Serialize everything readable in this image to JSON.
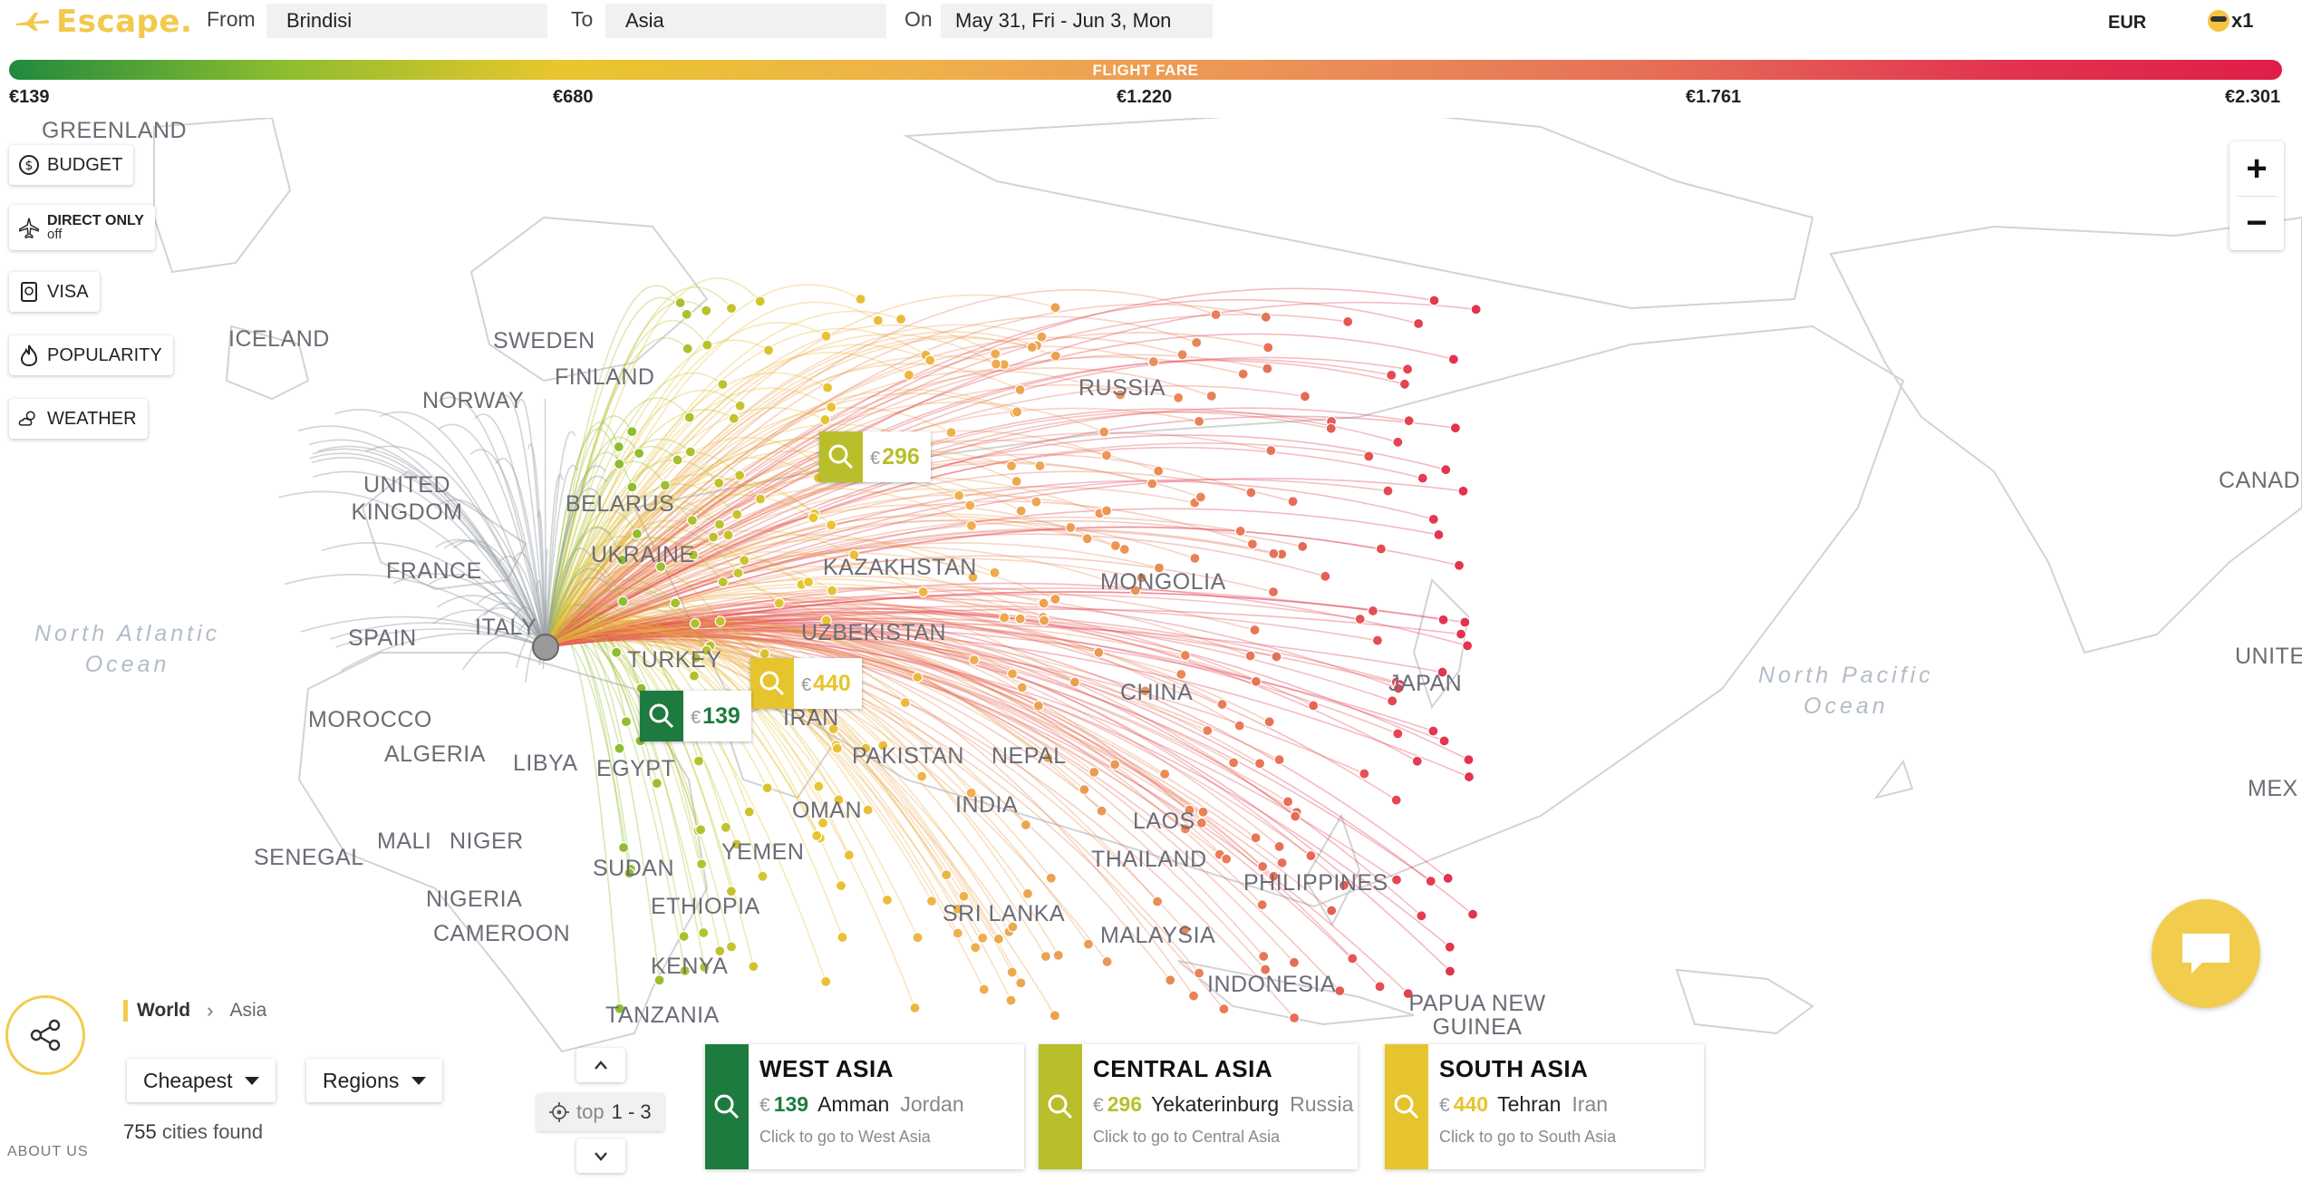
{
  "app": {
    "brand": "Escape."
  },
  "search": {
    "from_label": "From",
    "from_value": "Brindisi",
    "to_label": "To",
    "to_value": "Asia",
    "on_label": "On",
    "on_value": "May 31, Fri - Jun 3, Mon"
  },
  "currency": "EUR",
  "travelers": "x1",
  "fare_scale": {
    "title": "FLIGHT FARE",
    "ticks": [
      "€139",
      "€680",
      "€1.220",
      "€1.761",
      "€2.301"
    ]
  },
  "filters": {
    "budget": "BUDGET",
    "direct_only": "DIRECT ONLY",
    "direct_only_state": "off",
    "visa": "VISA",
    "popularity": "POPULARITY",
    "weather": "WEATHER"
  },
  "zoom": {
    "in": "+",
    "out": "−"
  },
  "map_labels": {
    "greenland": "GREENLAND",
    "iceland": "ICELAND",
    "sweden": "SWEDEN",
    "finland": "FINLAND",
    "norway": "NORWAY",
    "russia": "RUSSIA",
    "uk": "UNITED KINGDOM",
    "belarus": "BELARUS",
    "ukraine": "UKRAINE",
    "france": "FRANCE",
    "spain": "SPAIN",
    "italy": "ITALY",
    "kazakhstan": "KAZAKHSTAN",
    "mongolia": "MONGOLIA",
    "uzbekistan": "UZBEKISTAN",
    "turkey": "TURKEY",
    "iran": "IRAN",
    "china": "CHINA",
    "japan": "JAPAN",
    "morocco": "MOROCCO",
    "algeria": "ALGERIA",
    "libya": "LIBYA",
    "egypt": "EGYPT",
    "pakistan": "PAKISTAN",
    "nepal": "NEPAL",
    "india": "INDIA",
    "oman": "OMAN",
    "laos": "LAOS",
    "thailand": "THAILAND",
    "senegal": "SENEGAL",
    "mali": "MALI",
    "niger": "NIGER",
    "sudan": "SUDAN",
    "yemen": "YEMEN",
    "nigeria": "NIGERIA",
    "ethiopia": "ETHIOPIA",
    "philippines": "PHILIPPINES",
    "sri_lanka": "SRI LANKA",
    "cameroon": "CAMEROON",
    "malaysia": "MALAYSIA",
    "kenya": "KENYA",
    "indonesia": "INDONESIA",
    "papua": "PAPUA NEW GUINEA",
    "tanzania": "TANZANIA",
    "canada": "CANAD",
    "united": "UNITE",
    "mexico": "MEX",
    "n_atlantic": "North Atlantic\nOcean",
    "n_pacific": "North Pacific\nOcean"
  },
  "markers": [
    {
      "currency": "€",
      "price": "139",
      "color": "#1e7b3f"
    },
    {
      "currency": "€",
      "price": "296",
      "color": "#b8bf2a"
    },
    {
      "currency": "€",
      "price": "440",
      "color": "#e6c42e"
    }
  ],
  "breadcrumb": {
    "world": "World",
    "current": "Asia"
  },
  "sort": {
    "selected": "Cheapest"
  },
  "grouping": {
    "selected": "Regions"
  },
  "results": {
    "count": "755",
    "label": "cities found"
  },
  "footer": {
    "about": "ABOUT US"
  },
  "pager": {
    "label": "top",
    "range": "1 - 3"
  },
  "cards": [
    {
      "title": "WEST ASIA",
      "currency": "€",
      "price": "139",
      "city": "Amman",
      "country": "Jordan",
      "hint": "Click to go to West Asia",
      "color": "#1e7b3f"
    },
    {
      "title": "CENTRAL ASIA",
      "currency": "€",
      "price": "296",
      "city": "Yekaterinburg",
      "country": "Russia",
      "hint": "Click to go to Central Asia",
      "color": "#b8bf2a"
    },
    {
      "title": "SOUTH ASIA",
      "currency": "€",
      "price": "440",
      "city": "Tehran",
      "country": "Iran",
      "hint": "Click to go to South Asia",
      "color": "#e6c42e"
    }
  ]
}
